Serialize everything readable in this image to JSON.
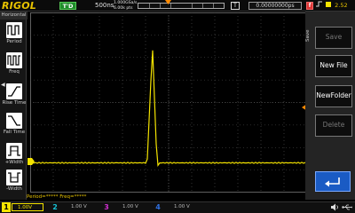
{
  "top_bar": {
    "brand": "RIGOL",
    "run_state": "T'D",
    "timebase": "500ns",
    "sample_rate": "1.000GSa/s",
    "points": "6.00k pts",
    "trigger_mode_glyph": "T",
    "delay": "0.00000000ps",
    "trigger_source_glyph": "f",
    "trigger_level": "2.52 V"
  },
  "left_panel": {
    "title": "Horizontal",
    "items": [
      {
        "label": "Period",
        "icon": "period-icon"
      },
      {
        "label": "Freq",
        "icon": "freq-icon"
      },
      {
        "label": "Rise Time",
        "icon": "rise-time-icon"
      },
      {
        "label": "Fall Time",
        "icon": "fall-time-icon"
      },
      {
        "label": "+Width",
        "icon": "positive-width-icon"
      },
      {
        "label": "-Width",
        "icon": "negative-width-icon"
      }
    ]
  },
  "right_menu": {
    "title": "Save",
    "buttons": [
      {
        "label": "Save",
        "enabled": false
      },
      {
        "label": "New File",
        "enabled": true
      },
      {
        "label": "NewFolder",
        "enabled": true
      },
      {
        "label": "Delete",
        "enabled": false
      }
    ],
    "return_icon": "return-arrow-icon"
  },
  "bottom_status": {
    "text": "Period=*****      Freq=*****"
  },
  "channels": [
    {
      "num": "1",
      "value": "1.00V",
      "color": "#f5e400",
      "active": true
    },
    {
      "num": "2",
      "value": "1.00 V",
      "color": "#17c3d6",
      "active": false
    },
    {
      "num": "3",
      "value": "1.00 V",
      "color": "#d12fd1",
      "active": false
    },
    {
      "num": "4",
      "value": "1.00 V",
      "color": "#2f6fe0",
      "active": false
    }
  ],
  "waveform": {
    "color": "#f5e400",
    "grid_divisions": {
      "x": 12,
      "y": 8
    },
    "baseline_level": 0,
    "pulse_peak_divisions": 5.2,
    "pulse_center_divisions": 5.3
  },
  "bottom_right_icons": [
    "speaker-icon",
    "usb-icon"
  ]
}
